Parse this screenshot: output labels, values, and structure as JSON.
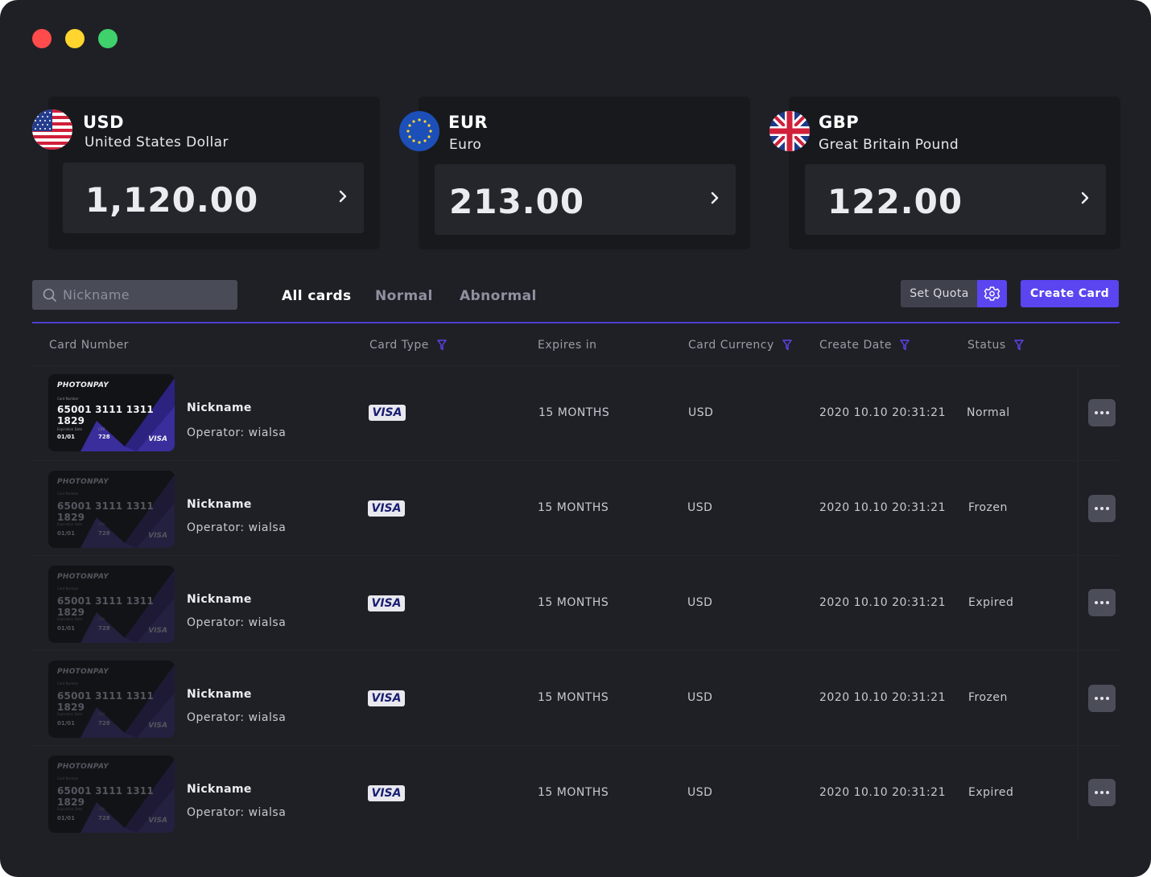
{
  "window": {
    "traffic_lights": [
      "#ff4b4b",
      "#ffd52e",
      "#3fd16b"
    ]
  },
  "accent": "#5a45f0",
  "currencies": [
    {
      "code": "USD",
      "name": "United States Dollar",
      "balance": "1,120.00",
      "flag": "us-flag-icon"
    },
    {
      "code": "EUR",
      "name": "Euro",
      "balance": "213.00",
      "flag": "eu-flag-icon"
    },
    {
      "code": "GBP",
      "name": "Great Britain Pound",
      "balance": "122.00",
      "flag": "uk-flag-icon"
    }
  ],
  "toolbar": {
    "search_placeholder": "Nickname",
    "tabs": [
      {
        "label": "All cards",
        "active": true
      },
      {
        "label": "Normal",
        "active": false
      },
      {
        "label": "Abnormal",
        "active": false
      }
    ],
    "set_quota_label": "Set Quota",
    "create_card_label": "Create Card"
  },
  "table": {
    "columns": [
      "Card Number",
      "Card Type",
      "Expires in",
      "Card Currency",
      "Create Date",
      "Status"
    ],
    "rows": [
      {
        "card": {
          "brand": "PHOTONPAY",
          "number_caption": "Card Number",
          "number": "65001 3111 1311 1829",
          "exp_caption": "Expiration Date",
          "cvv_caption": "CVV",
          "exp": "01/01",
          "cvv": "728",
          "network": "VISA"
        },
        "nickname": "Nickname",
        "operator": "Operator: wialsa",
        "type": "VISA",
        "expires": "15 MONTHS",
        "currency": "USD",
        "created": "2020 10.10 20:31:21",
        "status": "Normal"
      },
      {
        "card": {
          "brand": "PHOTONPAY",
          "number_caption": "Card Number",
          "number": "65001 3111 1311 1829",
          "exp_caption": "Expiration Date",
          "cvv_caption": "CVV",
          "exp": "01/01",
          "cvv": "728",
          "network": "VISA"
        },
        "nickname": "Nickname",
        "operator": "Operator: wialsa",
        "type": "VISA",
        "expires": "15 MONTHS",
        "currency": "USD",
        "created": "2020 10.10 20:31:21",
        "status": "Frozen"
      },
      {
        "card": {
          "brand": "PHOTONPAY",
          "number_caption": "Card Number",
          "number": "65001 3111 1311 1829",
          "exp_caption": "Expiration Date",
          "cvv_caption": "CVV",
          "exp": "01/01",
          "cvv": "728",
          "network": "VISA"
        },
        "nickname": "Nickname",
        "operator": "Operator: wialsa",
        "type": "VISA",
        "expires": "15 MONTHS",
        "currency": "USD",
        "created": "2020 10.10 20:31:21",
        "status": "Expired"
      },
      {
        "card": {
          "brand": "PHOTONPAY",
          "number_caption": "Card Number",
          "number": "65001 3111 1311 1829",
          "exp_caption": "Expiration Date",
          "cvv_caption": "CVV",
          "exp": "01/01",
          "cvv": "728",
          "network": "VISA"
        },
        "nickname": "Nickname",
        "operator": "Operator: wialsa",
        "type": "VISA",
        "expires": "15 MONTHS",
        "currency": "USD",
        "created": "2020 10.10 20:31:21",
        "status": "Frozen"
      },
      {
        "card": {
          "brand": "PHOTONPAY",
          "number_caption": "Card Number",
          "number": "65001 3111 1311 1829",
          "exp_caption": "Expiration Date",
          "cvv_caption": "CVV",
          "exp": "01/01",
          "cvv": "728",
          "network": "VISA"
        },
        "nickname": "Nickname",
        "operator": "Operator: wialsa",
        "type": "VISA",
        "expires": "15 MONTHS",
        "currency": "USD",
        "created": "2020 10.10 20:31:21",
        "status": "Expired"
      }
    ]
  }
}
